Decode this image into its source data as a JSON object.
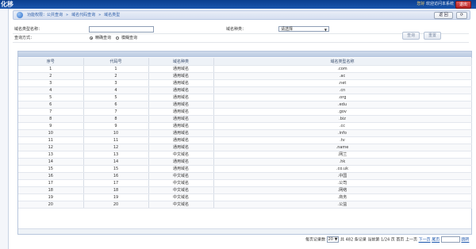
{
  "app": {
    "title": "化移"
  },
  "user": {
    "name": "您好",
    "welcome": "欢迎访问本系统"
  },
  "logout_label": "退出",
  "breadcrumb": {
    "items": [
      "功能权限：公共查询",
      "域名代码查询",
      "域名类型"
    ]
  },
  "breadcrumb_buttons": {
    "return": "返 回",
    "refresh": ""
  },
  "form": {
    "type_name_label": "域名类型名称：",
    "type_name_value": "",
    "kind_label": "域名种类：",
    "kind_value": "请选择",
    "query_mode_label": "查询方式：",
    "mode_exact": "精确查询",
    "mode_fuzzy": "模糊查询",
    "btn_query": "查询",
    "btn_reset": "重置"
  },
  "table": {
    "columns": [
      "序号",
      "代码号",
      "域名种类",
      "域名类型名称"
    ],
    "rows": [
      [
        "1",
        "1",
        "通用域名",
        ".com"
      ],
      [
        "2",
        "2",
        "通用域名",
        ".ac"
      ],
      [
        "3",
        "3",
        "通用域名",
        ".net"
      ],
      [
        "4",
        "4",
        "通用域名",
        ".cn"
      ],
      [
        "5",
        "5",
        "通用域名",
        ".org"
      ],
      [
        "6",
        "6",
        "通用域名",
        ".edu"
      ],
      [
        "7",
        "7",
        "通用域名",
        ".gov"
      ],
      [
        "8",
        "8",
        "通用域名",
        ".biz"
      ],
      [
        "9",
        "9",
        "通用域名",
        ".cc"
      ],
      [
        "10",
        "10",
        "通用域名",
        ".info"
      ],
      [
        "11",
        "11",
        "通用域名",
        ".tv"
      ],
      [
        "12",
        "12",
        "通用域名",
        ".name"
      ],
      [
        "13",
        "13",
        "中文域名",
        ".网兰"
      ],
      [
        "14",
        "14",
        "通用域名",
        ".hk"
      ],
      [
        "15",
        "15",
        "通用域名",
        ".co.uk"
      ],
      [
        "16",
        "16",
        "中文域名",
        ".中国"
      ],
      [
        "17",
        "17",
        "中文域名",
        ".公司"
      ],
      [
        "18",
        "18",
        "中文域名",
        ".网络"
      ],
      [
        "19",
        "19",
        "中文域名",
        ".商务"
      ],
      [
        "20",
        "20",
        "中文域名",
        ".公益"
      ]
    ]
  },
  "pager": {
    "per_page_label": "每页记录数",
    "per_page_value": "20",
    "total_text": "共 482 条记录",
    "page_text": "当前第 1/24 页",
    "first": "首页",
    "prev": "上一页",
    "next": "下一页",
    "last": "尾页",
    "go": "跳转"
  },
  "colors": {
    "topbar": "#0b3f8f",
    "link": "#1b56ad",
    "logout": "#c62828"
  }
}
